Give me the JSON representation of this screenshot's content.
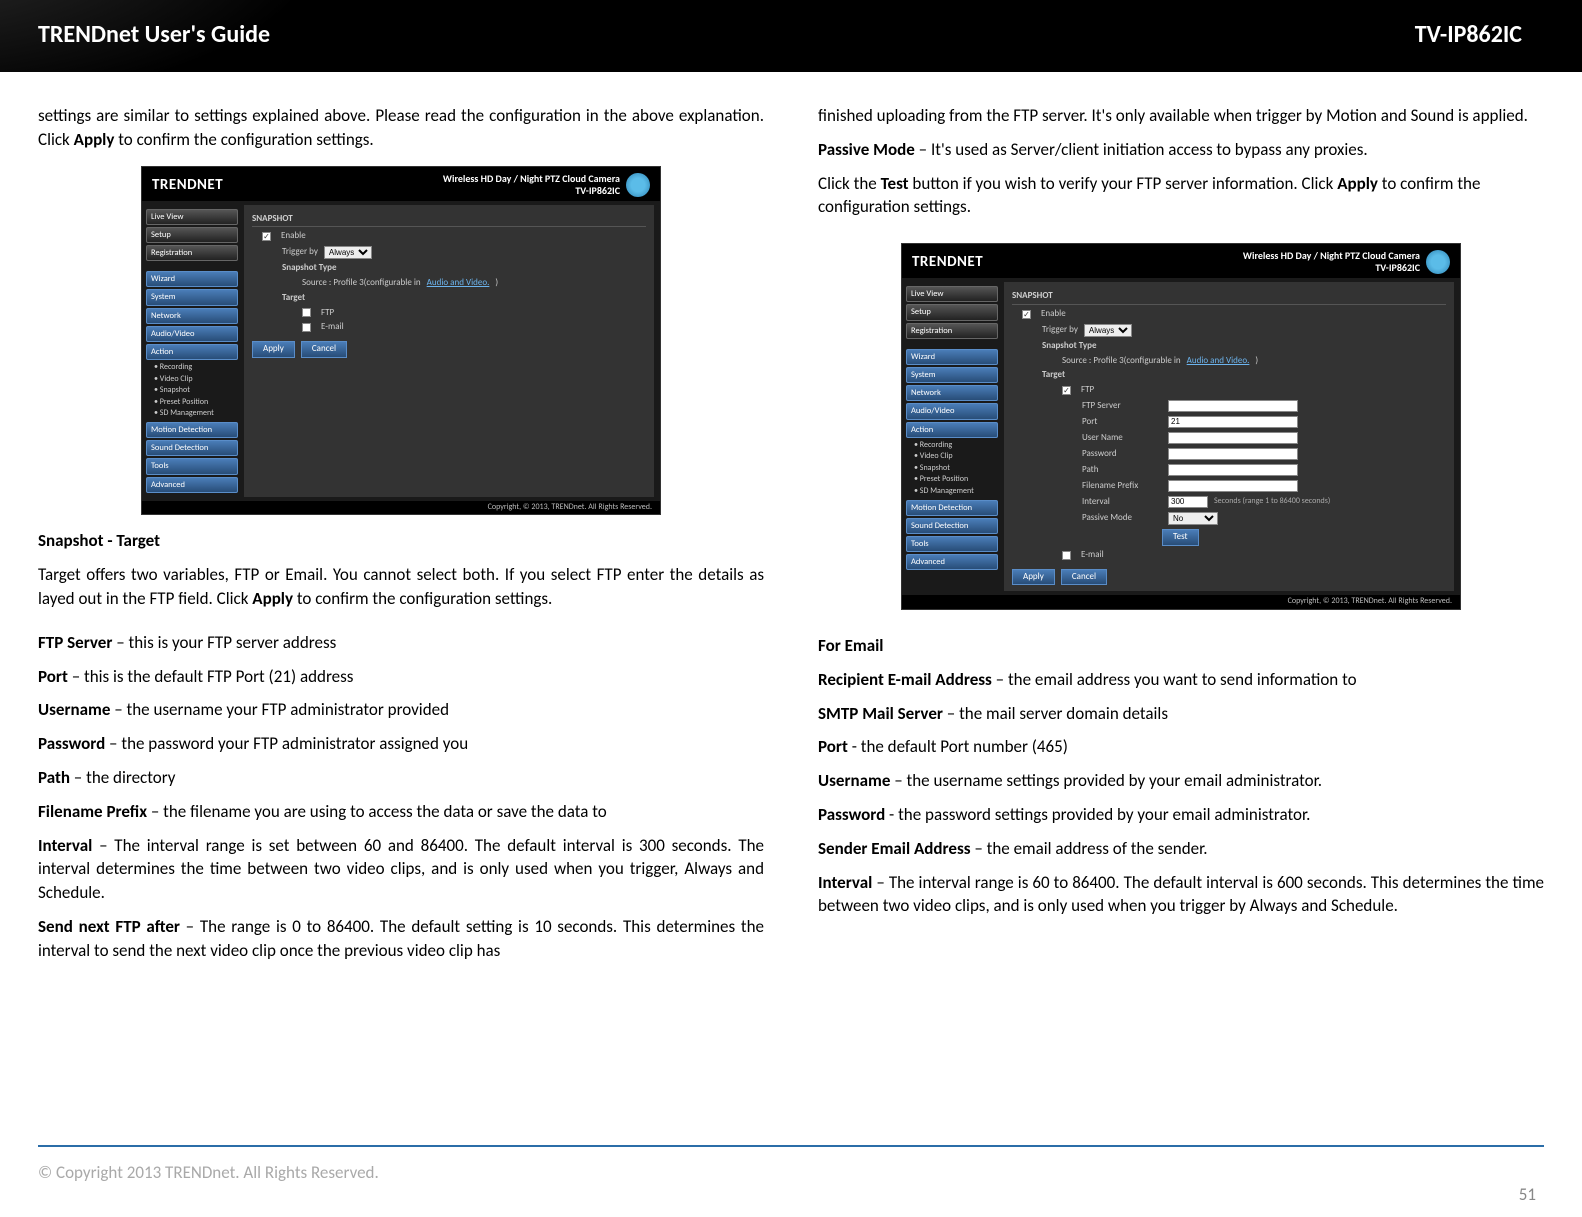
{
  "header": {
    "left": "TRENDnet User's Guide",
    "right": "TV-IP862IC"
  },
  "left_col": {
    "p1a": "settings are similar to settings explained above. Please read the configuration in the above explanation. Click ",
    "p1b": "Apply",
    "p1c": " to confirm the configuration settings.",
    "h_snapshot_target": "Snapshot - Target",
    "p2a": "Target offers two variables, FTP or Email. You cannot select both. If you select FTP enter the details as layed out in the FTP field. Click ",
    "p2b": "Apply",
    "p2c": " to confirm the configuration settings.",
    "defs": {
      "ftp_server_k": "FTP Server",
      "ftp_server_v": " – this is your FTP server address",
      "port_k": "Port",
      "port_v": " – this is the default FTP Port (21) address",
      "username_k": "Username",
      "username_v": " – the username your FTP administrator provided",
      "password_k": "Password",
      "password_v": " – the password your FTP administrator assigned you",
      "path_k": "Path",
      "path_v": " – the directory",
      "prefix_k": "Filename Prefix",
      "prefix_v": " – the filename you are using to access the data or save the data to"
    },
    "interval_k": "Interval",
    "interval_v": " – The interval range is set between 60 and 86400. The default interval is 300 seconds. The interval determines the time between two video clips, and is only used when you trigger, Always and Schedule.",
    "send_k": "Send next FTP after",
    "send_v": " – The range is 0 to 86400. The default setting is 10 seconds. This determines the interval to send the next video clip once the previous video clip has"
  },
  "right_col": {
    "p1": "finished uploading from the FTP server. It's only available when trigger by Motion and Sound is applied.",
    "passive_k": "Passive Mode",
    "passive_v": " – It's used as Server/client initiation access to bypass any proxies.",
    "p3a": "Click the ",
    "p3b": "Test",
    "p3c": " button if you wish to verify your FTP server information. Click ",
    "p3d": "Apply",
    "p3e": " to confirm the configuration settings.",
    "for_email": "For Email",
    "defs": {
      "recip_k": "Recipient E-mail Address",
      "recip_v": " – the email address you want to send information to",
      "smtp_k": "SMTP Mail Server",
      "smtp_v": " – the mail server domain details",
      "port_k": "Port",
      "port_v": " - the default Port number (465)",
      "user_k": "Username",
      "user_v": " – the username settings provided by your email administrator.",
      "pass_k": "Password",
      "pass_v": " - the password settings provided by your email administrator.",
      "sender_k": "Sender Email Address",
      "sender_v": " – the email address of the sender."
    },
    "interval_k": "Interval",
    "interval_v": " – The interval range is 60 to 86400. The default interval is 600 seconds. This determines the time between two video clips, and is only used when you trigger by Always and Schedule."
  },
  "ss_common": {
    "logo": "TRENDNET",
    "title1": "Wireless HD Day / Night PTZ Cloud Camera",
    "model": "TV-IP862IC",
    "foot": "Copyright, © 2013, TRENDnet. All Rights Reserved.",
    "nav_top": [
      "Live View",
      "Setup",
      "Registration"
    ],
    "nav_main": [
      "Wizard",
      "System",
      "Network",
      "Audio/Video",
      "Action"
    ],
    "nav_sub": [
      "• Recording",
      "• Video Clip",
      "• Snapshot",
      "• Preset Position",
      "• SD Management"
    ],
    "nav_bottom": [
      "Motion Detection",
      "Sound Detection",
      "Tools",
      "Advanced"
    ],
    "snapshot_h": "SNAPSHOT",
    "enable": "Enable",
    "trigger_by": "Trigger by",
    "trigger_opt": "Always",
    "snap_type": "Snapshot Type",
    "source_line": "Source : Profile 3(configurable in ",
    "source_link": "Audio and Video.",
    "source_end": ")",
    "target": "Target",
    "apply": "Apply",
    "cancel": "Cancel",
    "test": "Test"
  },
  "ss1": {
    "ftp_chk": "FTP",
    "email_chk": "E-mail"
  },
  "ss2": {
    "ftp_chk": "FTP",
    "fields": {
      "server": "FTP Server",
      "port": "Port",
      "port_val": "21",
      "user": "User Name",
      "pass": "Password",
      "path": "Path",
      "prefix": "Filename Prefix",
      "interval": "Interval",
      "interval_val": "300",
      "interval_hint": "Seconds (range 1 to 86400 seconds)",
      "passive": "Passive Mode",
      "passive_no": "No",
      "email_chk": "E-mail"
    }
  },
  "footer": {
    "copyright": "© Copyright 2013 TRENDnet. All Rights Reserved.",
    "page": "51"
  }
}
